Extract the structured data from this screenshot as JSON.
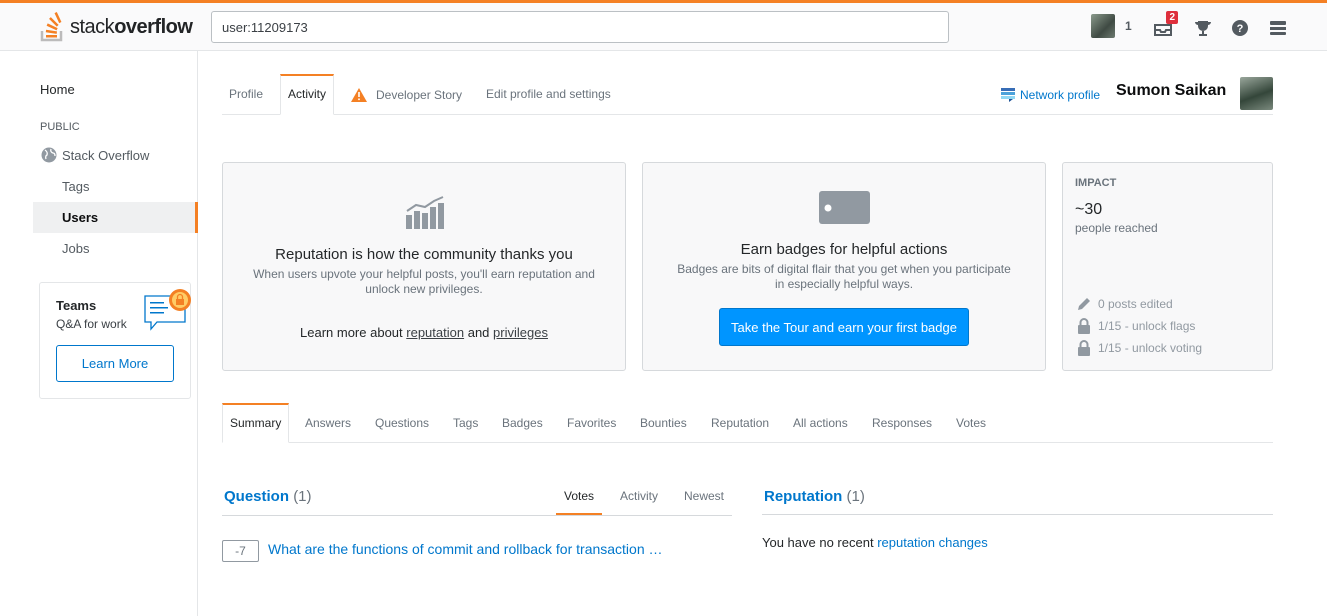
{
  "header": {
    "logo": {
      "prefix": "stack",
      "bold": "overflow"
    },
    "search_value": "user:11209173",
    "reputation": "1",
    "inbox_count": "2",
    "icons": [
      "inbox-icon",
      "trophy-icon",
      "help-icon",
      "site-switcher-icon"
    ]
  },
  "sidebar": {
    "home": "Home",
    "section": "PUBLIC",
    "stack_overflow": "Stack Overflow",
    "tags": "Tags",
    "users": "Users",
    "jobs": "Jobs",
    "teams": {
      "title": "Teams",
      "subtitle": "Q&A for work",
      "button": "Learn More"
    }
  },
  "profile_tabs": [
    "Profile",
    "Activity",
    "Developer Story",
    "Edit profile and settings"
  ],
  "network_profile": "Network profile",
  "user_name": "Sumon Saikan",
  "reputation_card": {
    "title": "Reputation is how the community thanks you",
    "subtitle": "When users upvote your helpful posts, you'll earn reputation and unlock new privileges.",
    "learn_prefix": "Learn more about",
    "learn_link1": "reputation",
    "learn_and": "and",
    "learn_link2": "privileges"
  },
  "badges_card": {
    "title": "Earn badges for helpful actions",
    "subtitle": "Badges are bits of digital flair that you get when you participate in especially helpful ways.",
    "button": "Take the Tour and earn your first badge"
  },
  "impact": {
    "label": "IMPACT",
    "value": "~30",
    "sub": "people reached",
    "posts_edited": "0 posts edited",
    "unlock_flags": "1/15 - unlock flags",
    "unlock_voting": "1/15 - unlock voting"
  },
  "activity_tabs": [
    "Summary",
    "Answers",
    "Questions",
    "Tags",
    "Badges",
    "Favorites",
    "Bounties",
    "Reputation",
    "All actions",
    "Responses",
    "Votes"
  ],
  "question_section": {
    "title": "Question",
    "count": "(1)",
    "sort": [
      "Votes",
      "Activity",
      "Newest"
    ],
    "score": "-7",
    "question": "What are the functions of commit and rollback for transaction …"
  },
  "reputation_section": {
    "title": "Reputation",
    "count": "(1)",
    "text_prefix": "You have no recent",
    "link": "reputation changes"
  },
  "colors": {
    "accent": "#f48024",
    "link": "#0077cc",
    "button": "#0095ff"
  }
}
